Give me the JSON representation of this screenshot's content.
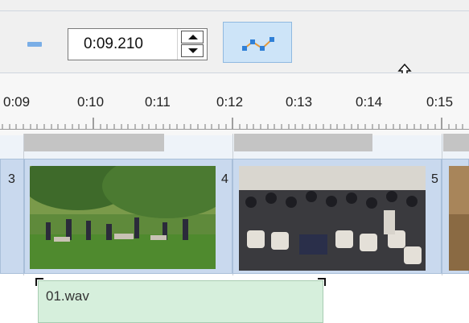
{
  "toolbar": {
    "zoom_out_icon": "minus-icon",
    "time_value": "0:09.210",
    "automation_icon": "automation-curve-icon",
    "accent": "#7aaee6"
  },
  "ruler": {
    "ticks": [
      "0:09",
      "0:10",
      "0:11",
      "0:12",
      "0:13",
      "0:14",
      "0:15"
    ]
  },
  "track": {
    "clips": [
      {
        "number": "3",
        "thumbnail": "outdoor-group-photo"
      },
      {
        "number": "4",
        "thumbnail": "audience-photo"
      },
      {
        "number": "5",
        "thumbnail": "partial-photo"
      }
    ]
  },
  "audio": {
    "label": "01.wav"
  }
}
